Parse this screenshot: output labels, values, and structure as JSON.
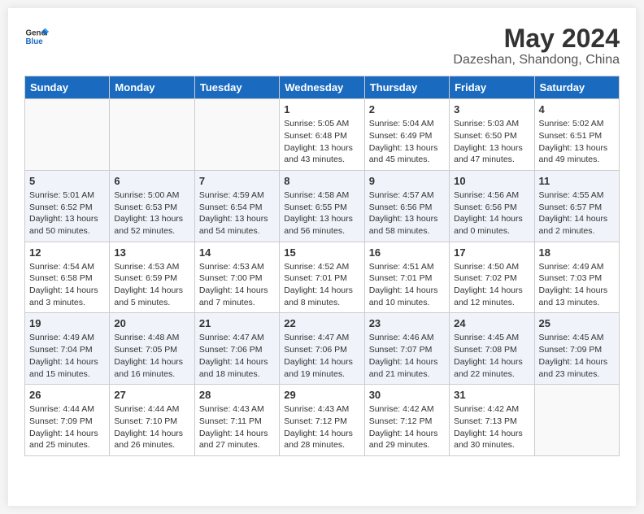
{
  "header": {
    "logo_line1": "General",
    "logo_line2": "Blue",
    "title": "May 2024",
    "subtitle": "Dazeshan, Shandong, China"
  },
  "days_of_week": [
    "Sunday",
    "Monday",
    "Tuesday",
    "Wednesday",
    "Thursday",
    "Friday",
    "Saturday"
  ],
  "weeks": [
    [
      {
        "day": "",
        "info": ""
      },
      {
        "day": "",
        "info": ""
      },
      {
        "day": "",
        "info": ""
      },
      {
        "day": "1",
        "info": "Sunrise: 5:05 AM\nSunset: 6:48 PM\nDaylight: 13 hours\nand 43 minutes."
      },
      {
        "day": "2",
        "info": "Sunrise: 5:04 AM\nSunset: 6:49 PM\nDaylight: 13 hours\nand 45 minutes."
      },
      {
        "day": "3",
        "info": "Sunrise: 5:03 AM\nSunset: 6:50 PM\nDaylight: 13 hours\nand 47 minutes."
      },
      {
        "day": "4",
        "info": "Sunrise: 5:02 AM\nSunset: 6:51 PM\nDaylight: 13 hours\nand 49 minutes."
      }
    ],
    [
      {
        "day": "5",
        "info": "Sunrise: 5:01 AM\nSunset: 6:52 PM\nDaylight: 13 hours\nand 50 minutes."
      },
      {
        "day": "6",
        "info": "Sunrise: 5:00 AM\nSunset: 6:53 PM\nDaylight: 13 hours\nand 52 minutes."
      },
      {
        "day": "7",
        "info": "Sunrise: 4:59 AM\nSunset: 6:54 PM\nDaylight: 13 hours\nand 54 minutes."
      },
      {
        "day": "8",
        "info": "Sunrise: 4:58 AM\nSunset: 6:55 PM\nDaylight: 13 hours\nand 56 minutes."
      },
      {
        "day": "9",
        "info": "Sunrise: 4:57 AM\nSunset: 6:56 PM\nDaylight: 13 hours\nand 58 minutes."
      },
      {
        "day": "10",
        "info": "Sunrise: 4:56 AM\nSunset: 6:56 PM\nDaylight: 14 hours\nand 0 minutes."
      },
      {
        "day": "11",
        "info": "Sunrise: 4:55 AM\nSunset: 6:57 PM\nDaylight: 14 hours\nand 2 minutes."
      }
    ],
    [
      {
        "day": "12",
        "info": "Sunrise: 4:54 AM\nSunset: 6:58 PM\nDaylight: 14 hours\nand 3 minutes."
      },
      {
        "day": "13",
        "info": "Sunrise: 4:53 AM\nSunset: 6:59 PM\nDaylight: 14 hours\nand 5 minutes."
      },
      {
        "day": "14",
        "info": "Sunrise: 4:53 AM\nSunset: 7:00 PM\nDaylight: 14 hours\nand 7 minutes."
      },
      {
        "day": "15",
        "info": "Sunrise: 4:52 AM\nSunset: 7:01 PM\nDaylight: 14 hours\nand 8 minutes."
      },
      {
        "day": "16",
        "info": "Sunrise: 4:51 AM\nSunset: 7:01 PM\nDaylight: 14 hours\nand 10 minutes."
      },
      {
        "day": "17",
        "info": "Sunrise: 4:50 AM\nSunset: 7:02 PM\nDaylight: 14 hours\nand 12 minutes."
      },
      {
        "day": "18",
        "info": "Sunrise: 4:49 AM\nSunset: 7:03 PM\nDaylight: 14 hours\nand 13 minutes."
      }
    ],
    [
      {
        "day": "19",
        "info": "Sunrise: 4:49 AM\nSunset: 7:04 PM\nDaylight: 14 hours\nand 15 minutes."
      },
      {
        "day": "20",
        "info": "Sunrise: 4:48 AM\nSunset: 7:05 PM\nDaylight: 14 hours\nand 16 minutes."
      },
      {
        "day": "21",
        "info": "Sunrise: 4:47 AM\nSunset: 7:06 PM\nDaylight: 14 hours\nand 18 minutes."
      },
      {
        "day": "22",
        "info": "Sunrise: 4:47 AM\nSunset: 7:06 PM\nDaylight: 14 hours\nand 19 minutes."
      },
      {
        "day": "23",
        "info": "Sunrise: 4:46 AM\nSunset: 7:07 PM\nDaylight: 14 hours\nand 21 minutes."
      },
      {
        "day": "24",
        "info": "Sunrise: 4:45 AM\nSunset: 7:08 PM\nDaylight: 14 hours\nand 22 minutes."
      },
      {
        "day": "25",
        "info": "Sunrise: 4:45 AM\nSunset: 7:09 PM\nDaylight: 14 hours\nand 23 minutes."
      }
    ],
    [
      {
        "day": "26",
        "info": "Sunrise: 4:44 AM\nSunset: 7:09 PM\nDaylight: 14 hours\nand 25 minutes."
      },
      {
        "day": "27",
        "info": "Sunrise: 4:44 AM\nSunset: 7:10 PM\nDaylight: 14 hours\nand 26 minutes."
      },
      {
        "day": "28",
        "info": "Sunrise: 4:43 AM\nSunset: 7:11 PM\nDaylight: 14 hours\nand 27 minutes."
      },
      {
        "day": "29",
        "info": "Sunrise: 4:43 AM\nSunset: 7:12 PM\nDaylight: 14 hours\nand 28 minutes."
      },
      {
        "day": "30",
        "info": "Sunrise: 4:42 AM\nSunset: 7:12 PM\nDaylight: 14 hours\nand 29 minutes."
      },
      {
        "day": "31",
        "info": "Sunrise: 4:42 AM\nSunset: 7:13 PM\nDaylight: 14 hours\nand 30 minutes."
      },
      {
        "day": "",
        "info": ""
      }
    ]
  ]
}
